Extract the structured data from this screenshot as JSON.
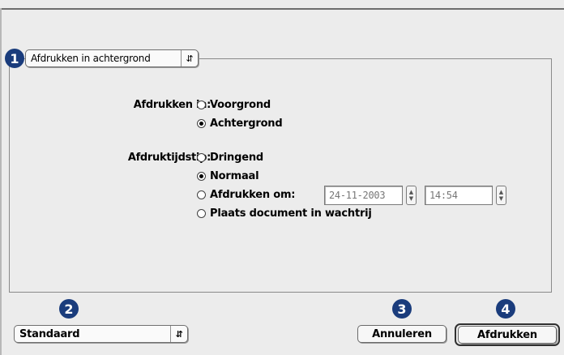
{
  "panel_menu": {
    "selected": "Afdrukken in achtergrond"
  },
  "print_in": {
    "label": "Afdrukken in:",
    "options": [
      {
        "label": "Voorgrond",
        "selected": false
      },
      {
        "label": "Achtergrond",
        "selected": true
      }
    ]
  },
  "print_time": {
    "label": "Afdruktijdstip:",
    "options": [
      {
        "label": "Dringend",
        "selected": false
      },
      {
        "label": "Normaal",
        "selected": true
      },
      {
        "label": "Afdrukken om:",
        "selected": false
      },
      {
        "label": "Plaats document in wachtrij",
        "selected": false
      }
    ],
    "date_value": "24-11-2003",
    "time_value": "14:54"
  },
  "presets": {
    "selected": "Standaard"
  },
  "buttons": {
    "cancel": "Annuleren",
    "print": "Afdrukken"
  },
  "callouts": [
    "1",
    "2",
    "3",
    "4"
  ],
  "colors": {
    "callout": "#1a3c7c",
    "background": "#ececec"
  },
  "icons": {
    "popup_arrows": "up-down-arrows-icon",
    "stepper": "stepper-arrows-icon"
  }
}
